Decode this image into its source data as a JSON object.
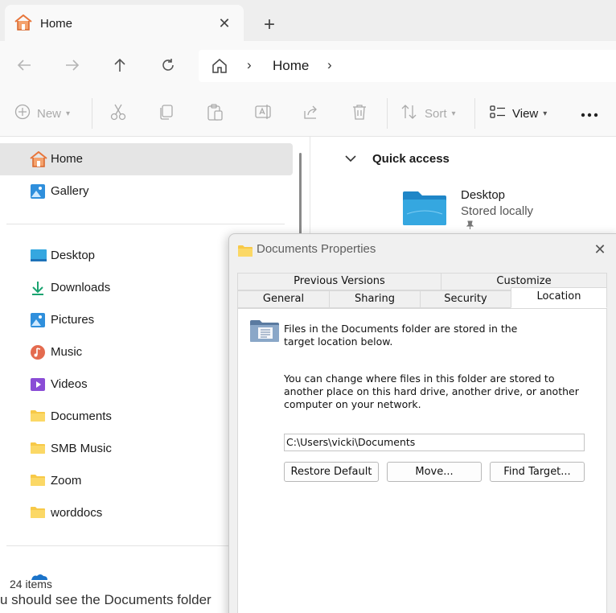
{
  "tab": {
    "title": "Home"
  },
  "navigation": {
    "breadcrumb_current": "Home"
  },
  "commands": {
    "new_label": "New",
    "sort_label": "Sort",
    "view_label": "View"
  },
  "sidebar": {
    "top_items": [
      {
        "label": "Home",
        "icon": "home-icon",
        "selected": true
      },
      {
        "label": "Gallery",
        "icon": "gallery-icon"
      }
    ],
    "items": [
      {
        "label": "Desktop",
        "icon": "desktop-icon"
      },
      {
        "label": "Downloads",
        "icon": "download-icon"
      },
      {
        "label": "Pictures",
        "icon": "pictures-icon"
      },
      {
        "label": "Music",
        "icon": "music-icon"
      },
      {
        "label": "Videos",
        "icon": "videos-icon"
      },
      {
        "label": "Documents",
        "icon": "folder-icon"
      },
      {
        "label": "SMB Music",
        "icon": "folder-icon"
      },
      {
        "label": "Zoom",
        "icon": "folder-icon"
      },
      {
        "label": "worddocs",
        "icon": "folder-icon"
      }
    ]
  },
  "status": {
    "items_count": "24 items"
  },
  "background_text": "u should see the Documents folder",
  "content": {
    "section_title": "Quick access",
    "tile": {
      "name": "Desktop",
      "subtitle": "Stored locally"
    }
  },
  "dialog": {
    "title": "Documents Properties",
    "tabs_row1": [
      "Previous Versions",
      "Customize"
    ],
    "tabs_row2": [
      "General",
      "Sharing",
      "Security",
      "Location"
    ],
    "selected_tab": "Location",
    "info_text": "Files in the Documents folder are stored in the target location below.",
    "change_text": "You can change where files in this folder are stored to another place on this hard drive, another drive, or another computer on your network.",
    "path": "C:\\Users\\vicki\\Documents",
    "buttons": {
      "restore": "Restore Default",
      "move": "Move...",
      "find": "Find Target..."
    }
  },
  "colors": {
    "folder": "#f7c948",
    "desktop_folder": "#2d9fd8",
    "selected_bg": "#e5e5e5",
    "home_icon": "#e8753a"
  }
}
